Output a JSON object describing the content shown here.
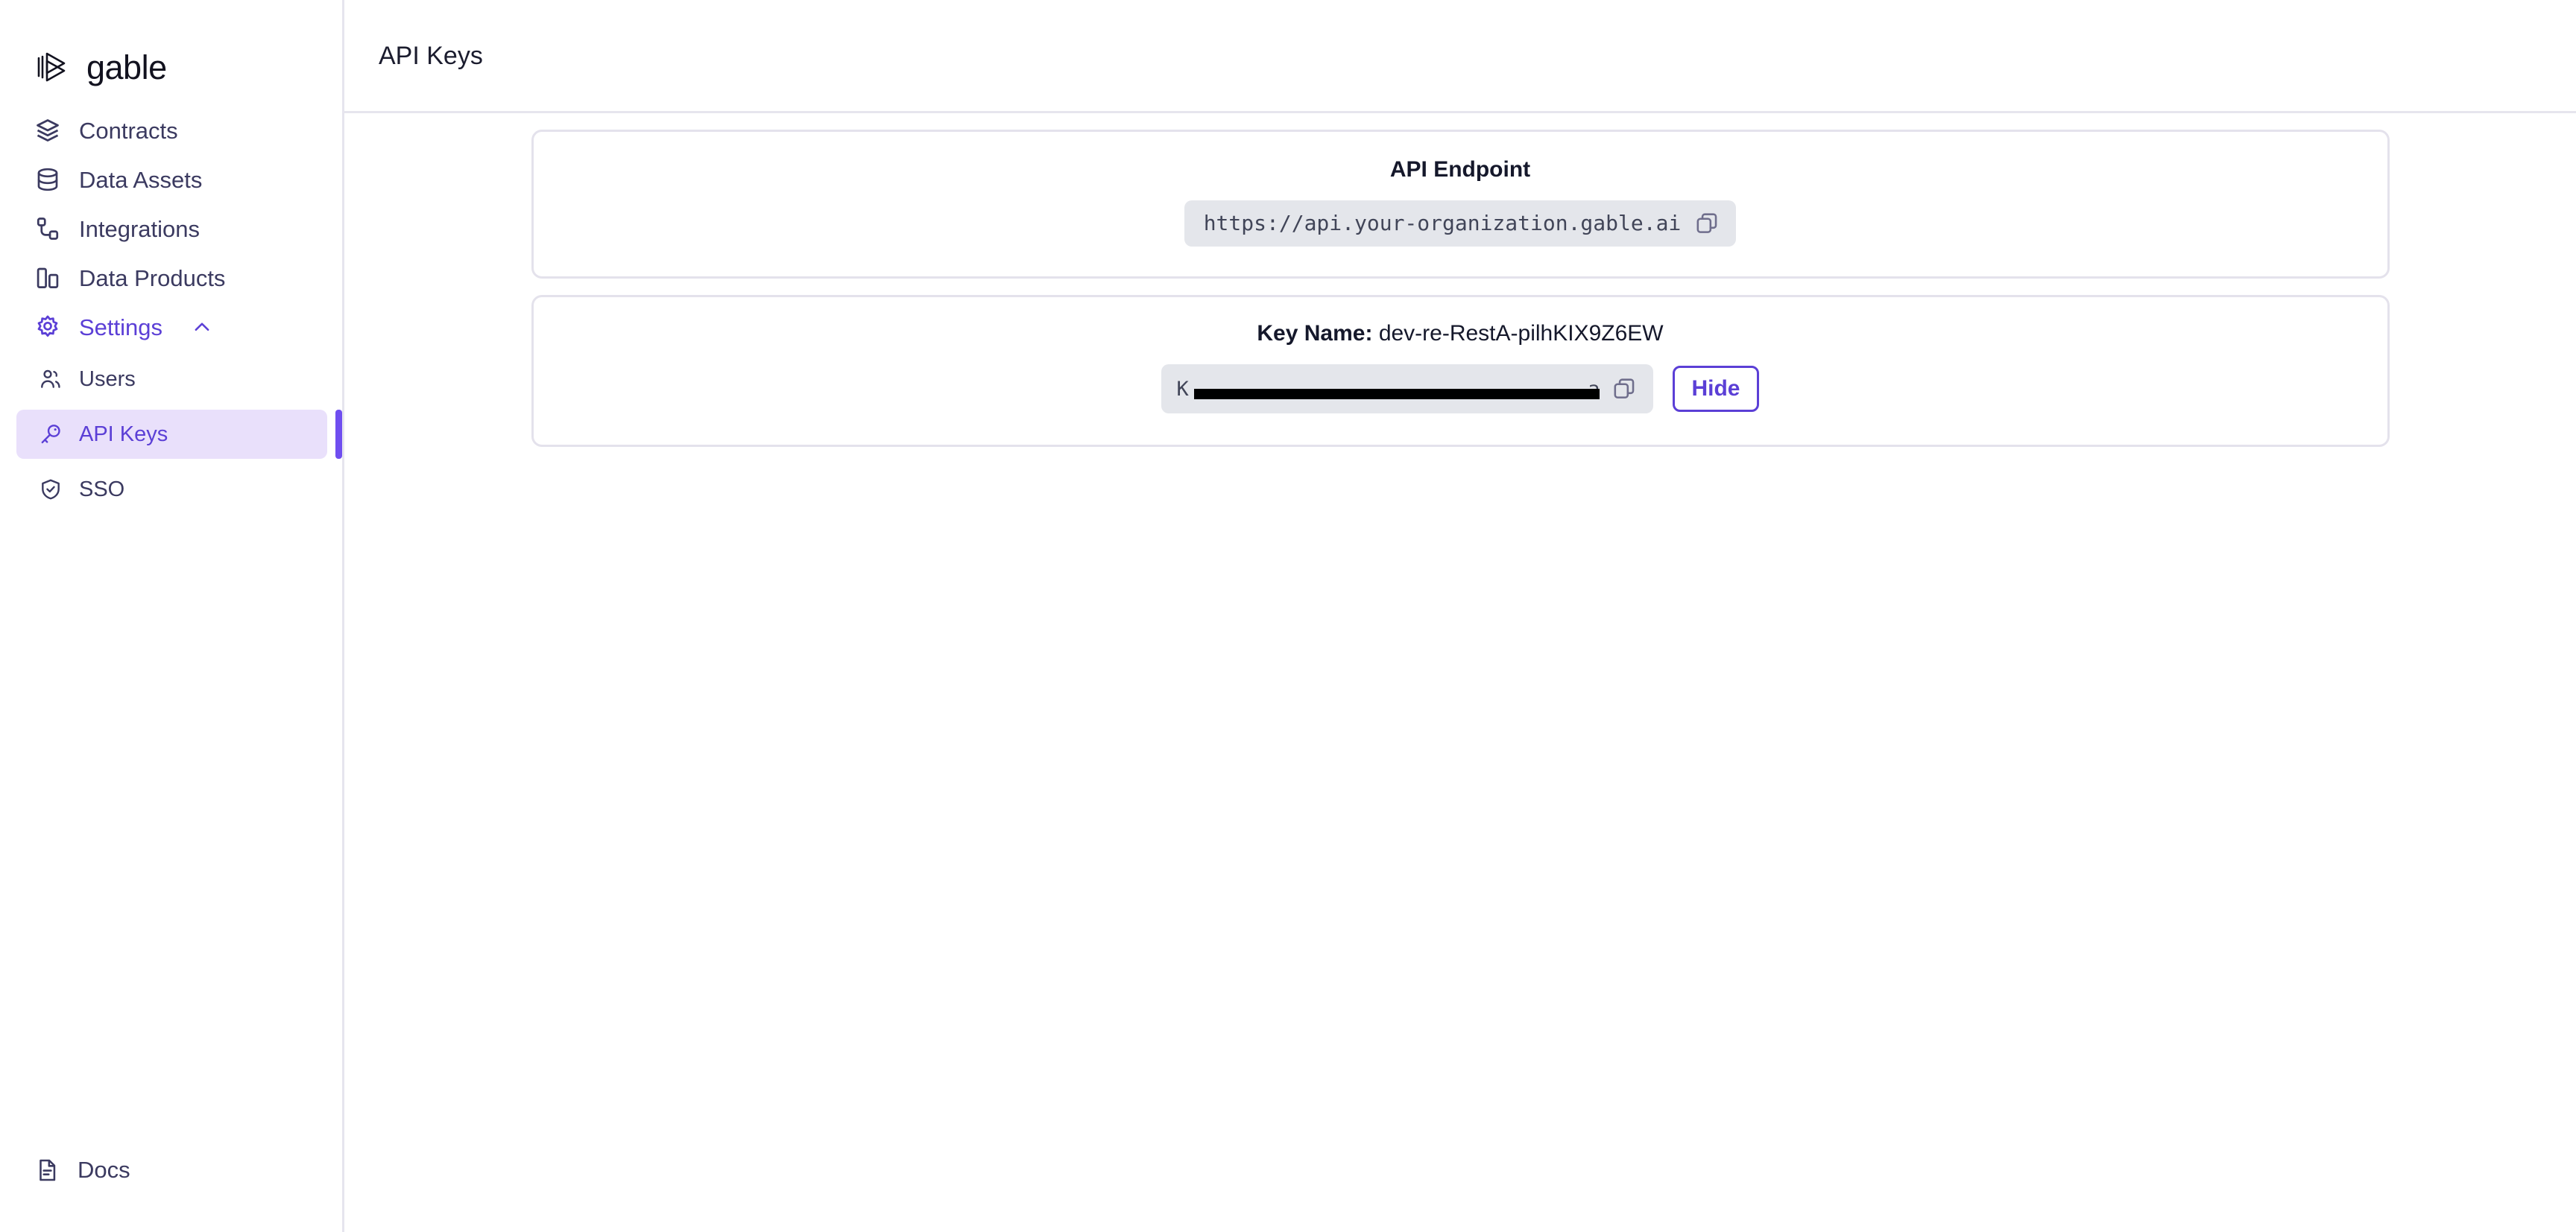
{
  "brand": {
    "name": "gable",
    "logo_icon": "gable-logo-icon"
  },
  "sidebar": {
    "items": [
      {
        "label": "Contracts",
        "icon": "layers-icon"
      },
      {
        "label": "Data Assets",
        "icon": "database-icon"
      },
      {
        "label": "Integrations",
        "icon": "nodes-icon"
      },
      {
        "label": "Data Products",
        "icon": "bar-chart-icon"
      }
    ],
    "settings": {
      "label": "Settings",
      "icon": "gear-icon",
      "chevron": "chevron-up-icon",
      "expanded": true,
      "sub_items": [
        {
          "label": "Users",
          "icon": "users-icon",
          "active": false
        },
        {
          "label": "API Keys",
          "icon": "key-icon",
          "active": true
        },
        {
          "label": "SSO",
          "icon": "shield-check-icon",
          "active": false
        }
      ]
    },
    "docs": {
      "label": "Docs",
      "icon": "document-icon"
    }
  },
  "header": {
    "title": "API Keys"
  },
  "endpoint_card": {
    "heading": "API Endpoint",
    "url": "https://api.your-organization.gable.ai",
    "copy_icon": "copy-icon"
  },
  "key_card": {
    "heading_label": "Key Name:",
    "key_name": "dev-re-RestA-pilhKIX9Z6EW",
    "key_value_prefix": "K",
    "key_value_suffix": "a",
    "key_redacted": true,
    "copy_icon": "copy-icon",
    "toggle_label": "Hide"
  },
  "colors": {
    "accent": "#5b3fd6",
    "accent_bar": "#6f4ef0",
    "active_bg": "#e9e0fb",
    "nav_text": "#3b3a60",
    "card_border": "#e4e2ec",
    "chip_bg": "#e4e6eb",
    "redaction": "#000000"
  }
}
